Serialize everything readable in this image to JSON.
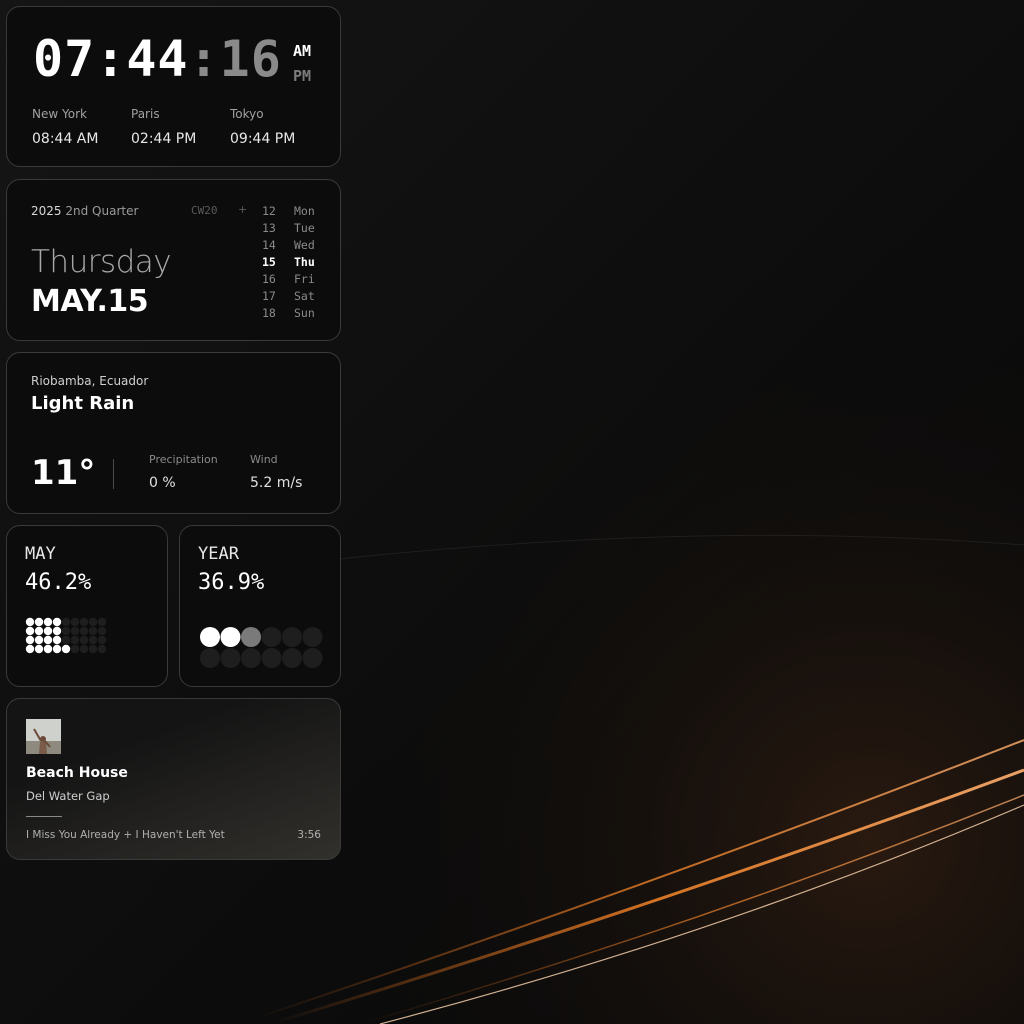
{
  "clock": {
    "hours": "07",
    "sep1": ":",
    "minutes": "44",
    "sep2": ":",
    "seconds": "16",
    "am": "AM",
    "pm": "PM",
    "zones": [
      {
        "city": "New York",
        "time": "08:44 AM"
      },
      {
        "city": "Paris",
        "time": "02:44 PM"
      },
      {
        "city": "Tokyo",
        "time": "09:44 PM"
      }
    ]
  },
  "date": {
    "year": "2025",
    "quarter": "2nd Quarter",
    "calendar_week": "CW20",
    "plus": "+",
    "weekday": "Thursday",
    "date": "MAY.15",
    "week": [
      {
        "num": "12",
        "day": "Mon"
      },
      {
        "num": "13",
        "day": "Tue"
      },
      {
        "num": "14",
        "day": "Wed"
      },
      {
        "num": "15",
        "day": "Thu",
        "active": true
      },
      {
        "num": "16",
        "day": "Fri"
      },
      {
        "num": "17",
        "day": "Sat"
      },
      {
        "num": "18",
        "day": "Sun"
      }
    ]
  },
  "weather": {
    "location": "Riobamba, Ecuador",
    "condition": "Light Rain",
    "temperature": "11°",
    "precip_label": "Precipitation",
    "precip_value": "0 %",
    "wind_label": "Wind",
    "wind_value": "5.2 m/s"
  },
  "progress": {
    "month": {
      "label": "MAY",
      "value": "46.2%",
      "fraction": 0.462
    },
    "year": {
      "label": "YEAR",
      "value": "36.9%",
      "fraction": 0.369
    }
  },
  "music": {
    "artist": "Beach House",
    "album": "Del Water Gap",
    "song": "I Miss You Already + I Haven't Left Yet",
    "duration": "3:56"
  },
  "colors": {
    "accent_orange": "#ff8a2a",
    "card_border": "#3a3a3a",
    "muted_text": "#8a8a8a"
  }
}
